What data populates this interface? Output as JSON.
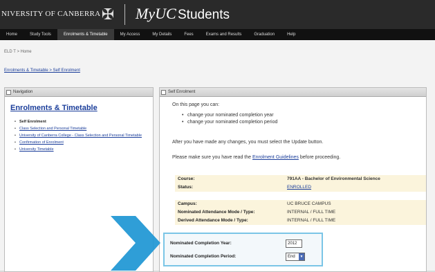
{
  "header": {
    "university": "NIVERSITY OF CANBERRA",
    "crest_icon": "crest-icon",
    "myuc": "MyUC",
    "students": "Students"
  },
  "nav": {
    "items": [
      "Home",
      "Study Tools",
      "Enrolments & Timetable",
      "My Access",
      "My Details",
      "Fees",
      "Exams and Results",
      "Graduation",
      "Help"
    ],
    "active_index": 2
  },
  "breadcrumb_top": "ELD T > Home",
  "breadcrumb_link": "Enrolments & Timetable > Self Enrolment",
  "left_panel": {
    "header": "Navigation",
    "title": "Enrolments & Timetable",
    "items": [
      "Self Enrolment",
      "Class Selection and Personal Timetable",
      "University of Canberra College - Class Selection and Personal Timetable",
      "Confirmation of Enrolment",
      "University Timetable"
    ]
  },
  "right_panel": {
    "header": "Self Enrolment",
    "intro": "On this page you can:",
    "bullets": [
      "change your nominated completion year",
      "change your nominated completion period"
    ],
    "after": "After you have made any changes, you must select the Update button.",
    "please_prefix": "Please make sure you have read the ",
    "please_link": "Enrolment Guidelines",
    "please_suffix": " before proceeding.",
    "rows1": [
      {
        "label": "Course:",
        "value": "791AA - Bachelor of Environmental Science"
      },
      {
        "label": "Status:",
        "value": "ENROLLED"
      }
    ],
    "rows2": [
      {
        "label": "Campus:",
        "value": "UC BRUCE CAMPUS"
      },
      {
        "label": "Nominated Attendance Mode / Type:",
        "value": "INTERNAL / FULL TIME"
      },
      {
        "label": "Derived Attendance Mode / Type:",
        "value": "INTERNAL / FULL TIME"
      }
    ]
  },
  "completion": {
    "year_label": "Nominated Completion Year:",
    "year_value": "2012",
    "period_label": "Nominated Completion Period:",
    "period_value": "End"
  },
  "colors": {
    "highlight_border": "#7ac5e6",
    "arrow": "#1f97d4",
    "header_bg": "#2a2a2a"
  }
}
